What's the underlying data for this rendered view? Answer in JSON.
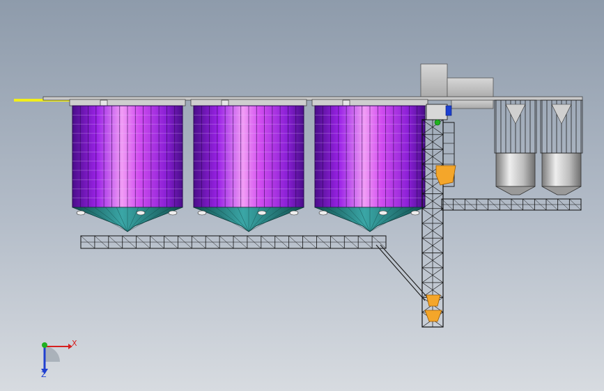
{
  "viewport": {
    "background_top": "#8e9bab",
    "background_bottom": "#d7dbe0"
  },
  "colors": {
    "silo_wall": "#a21fe0",
    "silo_highlight": "#f19cf5",
    "silo_cone": "#2e8c8c",
    "storage_bin": "#c6c6c6",
    "frame": "#111111",
    "conveyor": "#f2ef1a",
    "elevator_boot": "#f4a62a",
    "motor": "#1c3fd0"
  },
  "components": {
    "large_silos": 3,
    "storage_bins": 2
  },
  "triad": {
    "x_label": "X",
    "z_label": "Z",
    "x_color": "#d62020",
    "y_color": "#20b020",
    "z_color": "#2040d0"
  }
}
